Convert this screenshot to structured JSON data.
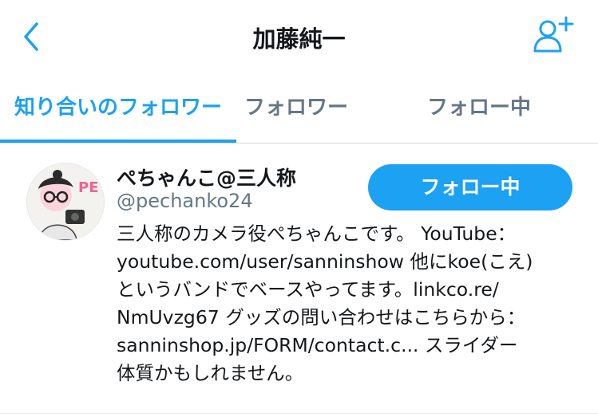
{
  "header": {
    "title": "加藤純一",
    "back_icon": "chevron-left-icon",
    "add_user_icon": "add-user-icon",
    "accent_color": "#1da1f2"
  },
  "tabs": [
    {
      "label": "知り合いのフォロワー",
      "active": true
    },
    {
      "label": "フォロワー",
      "active": false
    },
    {
      "label": "フォロー中",
      "active": false
    }
  ],
  "user": {
    "name": "ぺちゃんこ@三人称",
    "handle": "@pechanko24",
    "follow_button_label": "フォロー中",
    "avatar_text": "PE",
    "bio_lines": [
      "三人称のカメラ役ぺちゃんこです。 YouTube：",
      "youtube.com/user/sanninshow 他にkoe(こえ)",
      "というバンドでベースやってます。linkco.re/",
      "NmUvzg67 グッズの問い合わせはこちらから：",
      "sanninshop.jp/FORM/contact.c... スライダー",
      "体質かもしれません。"
    ]
  }
}
